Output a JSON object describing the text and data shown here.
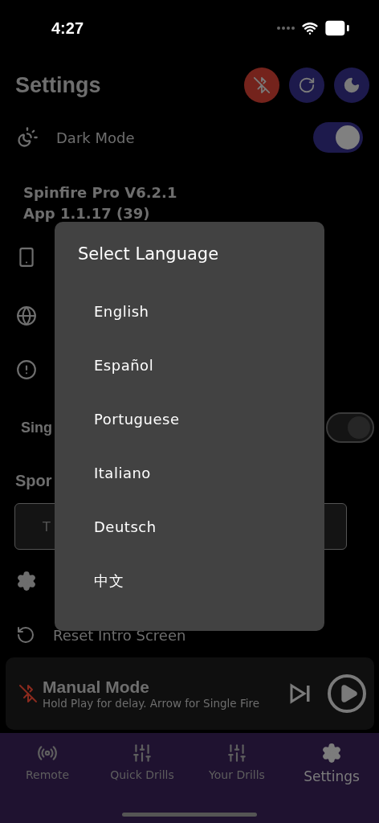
{
  "status_bar": {
    "time": "4:27"
  },
  "header": {
    "title": "Settings",
    "buttons": [
      {
        "kind": "bluetooth"
      },
      {
        "kind": "refresh"
      },
      {
        "kind": "theme"
      }
    ]
  },
  "dark_mode": {
    "label": "Dark Mode",
    "on": true
  },
  "version": {
    "product": "Spinfire Pro V6.2.1",
    "app": "App 1.1.17 (39)"
  },
  "rows": [
    {
      "kind": "download"
    },
    {
      "kind": "language"
    },
    {
      "kind": "alert"
    }
  ],
  "single_fire": {
    "label": "Sing",
    "on": true
  },
  "sport": {
    "label": "Spor",
    "field": "T"
  },
  "more_rows": [
    {
      "kind": "gear"
    },
    {
      "kind": "reset",
      "label": "Reset Intro Screen"
    }
  ],
  "dialog": {
    "title": "Select Language",
    "options": [
      {
        "label": "English"
      },
      {
        "label": "Español"
      },
      {
        "label": "Portuguese"
      },
      {
        "label": "Italiano"
      },
      {
        "label": "Deutsch"
      },
      {
        "label": "中文"
      }
    ]
  },
  "player": {
    "title": "Manual Mode",
    "subtitle": "Hold Play for delay. Arrow for Single Fire",
    "connected": false
  },
  "tabs": [
    {
      "label": "Remote",
      "kind": "remote",
      "selected": false
    },
    {
      "label": "Quick Drills",
      "kind": "drills",
      "selected": false
    },
    {
      "label": "Your Drills",
      "kind": "drills",
      "selected": false
    },
    {
      "label": "Settings",
      "kind": "settings",
      "selected": true
    }
  ]
}
